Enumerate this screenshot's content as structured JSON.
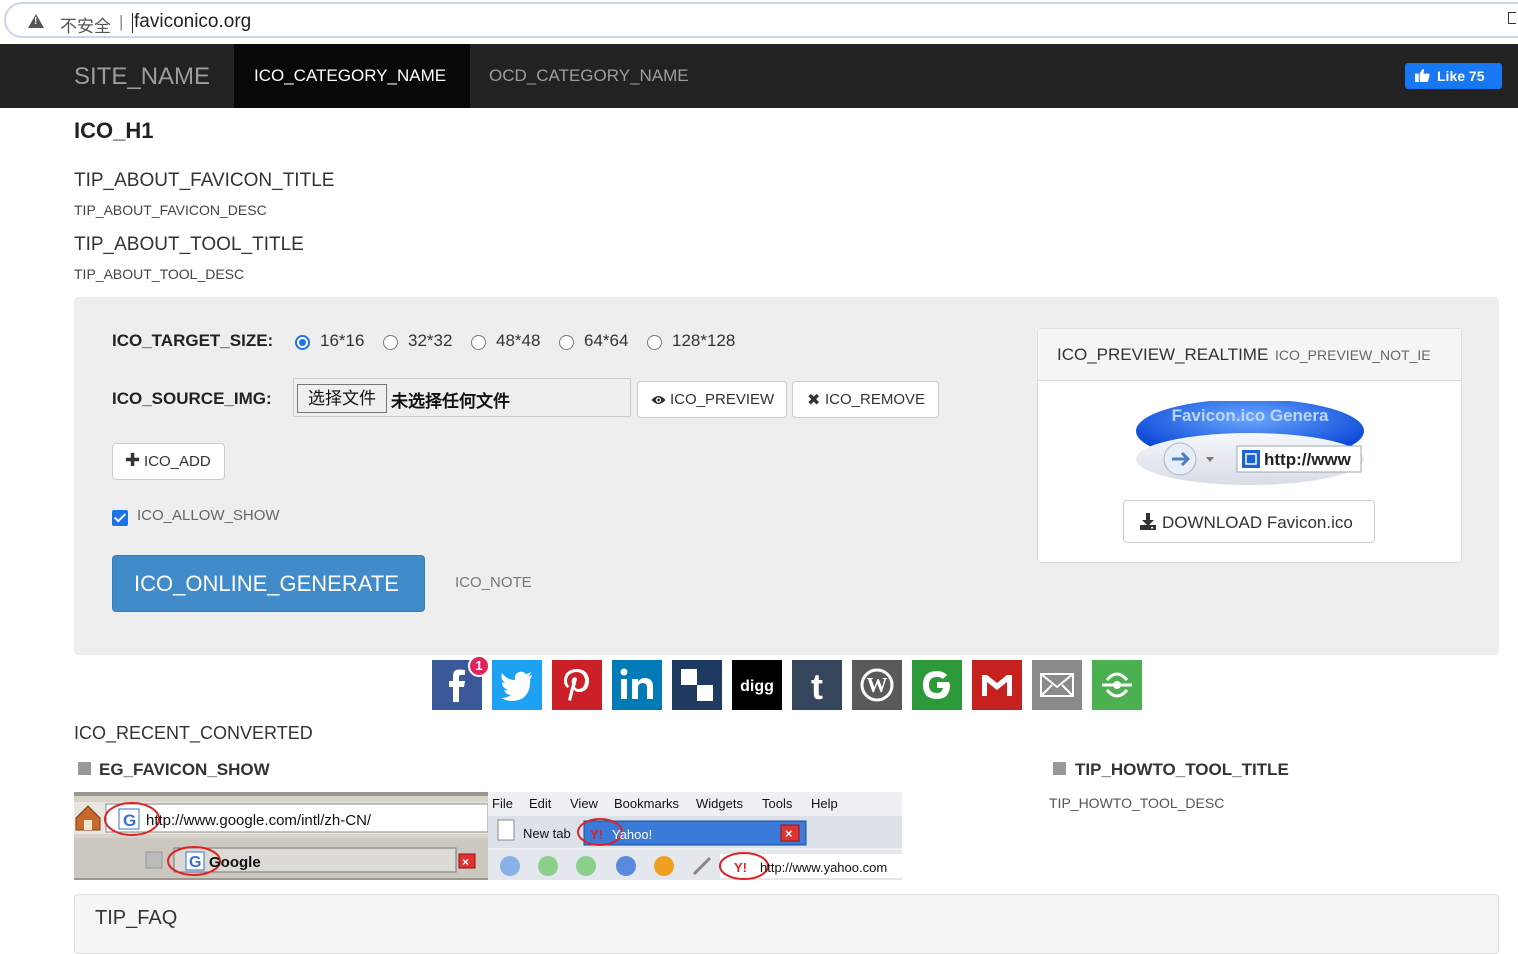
{
  "browser": {
    "security_label": "不安全",
    "separator": "|",
    "url": "faviconico.org"
  },
  "navbar": {
    "brand": "SITE_NAME",
    "items": [
      {
        "label": "ICO_CATEGORY_NAME",
        "active": true
      },
      {
        "label": "OCD_CATEGORY_NAME",
        "active": false
      }
    ],
    "like_label": "Like 75",
    "like_color": "#1877f2"
  },
  "page": {
    "h1": "ICO_H1",
    "tips": [
      {
        "title": "TIP_ABOUT_FAVICON_TITLE",
        "desc": "TIP_ABOUT_FAVICON_DESC"
      },
      {
        "title": "TIP_ABOUT_TOOL_TITLE",
        "desc": "TIP_ABOUT_TOOL_DESC"
      }
    ]
  },
  "tool": {
    "target_size_label": "ICO_TARGET_SIZE:",
    "sizes": [
      {
        "label": "16*16",
        "selected": true
      },
      {
        "label": "32*32",
        "selected": false
      },
      {
        "label": "48*48",
        "selected": false
      },
      {
        "label": "64*64",
        "selected": false
      },
      {
        "label": "128*128",
        "selected": false
      }
    ],
    "source_img_label": "ICO_SOURCE_IMG:",
    "file_button": "选择文件",
    "file_status": "未选择任何文件",
    "preview_button": "ICO_PREVIEW",
    "remove_button": "ICO_REMOVE",
    "add_button": "ICO_ADD",
    "allow_show_label": "ICO_ALLOW_SHOW",
    "allow_show_checked": true,
    "generate_button": "ICO_ONLINE_GENERATE",
    "note": "ICO_NOTE",
    "primary_color": "#428bca"
  },
  "preview_panel": {
    "title": "ICO_PREVIEW_REALTIME",
    "subtitle": "ICO_PREVIEW_NOT_IE",
    "image_caption": "Favicon.ico Genera",
    "image_url_text": "http://www",
    "download_button": "DOWNLOAD Favicon.ico"
  },
  "share": {
    "facebook_badge": "1",
    "buttons": [
      {
        "icon": "facebook-icon",
        "color": "#3b5998"
      },
      {
        "icon": "twitter-icon",
        "color": "#1da1f2"
      },
      {
        "icon": "pinterest-icon",
        "color": "#cb2027"
      },
      {
        "icon": "linkedin-icon",
        "color": "#007bb5"
      },
      {
        "icon": "delicious-icon",
        "color": "#205cc0"
      },
      {
        "icon": "digg-icon",
        "color": "#000000"
      },
      {
        "icon": "tumblr-icon",
        "color": "#35465c"
      },
      {
        "icon": "wordpress-icon",
        "color": "#464646"
      },
      {
        "icon": "google-icon",
        "color": "#2d9a3a"
      },
      {
        "icon": "gmail-icon",
        "color": "#c5221f"
      },
      {
        "icon": "email-icon",
        "color": "#888888"
      },
      {
        "icon": "more-share-icon",
        "color": "#4caf50"
      }
    ]
  },
  "bottom": {
    "recent_converted": "ICO_RECENT_CONVERTED",
    "eg_title": "EG_FAVICON_SHOW",
    "howto_title": "TIP_HOWTO_TOOL_TITLE",
    "howto_desc": "TIP_HOWTO_TOOL_DESC",
    "eg_image": {
      "google_url": "http://www.google.com/intl/zh-CN/",
      "google_tab": "Google",
      "menu": [
        "File",
        "Edit",
        "View",
        "Bookmarks",
        "Widgets",
        "Tools",
        "Help"
      ],
      "new_tab": "New tab",
      "yahoo_tab": "Yahoo!",
      "yahoo_url": "http://www.yahoo.com"
    },
    "faq_title": "TIP_FAQ"
  }
}
